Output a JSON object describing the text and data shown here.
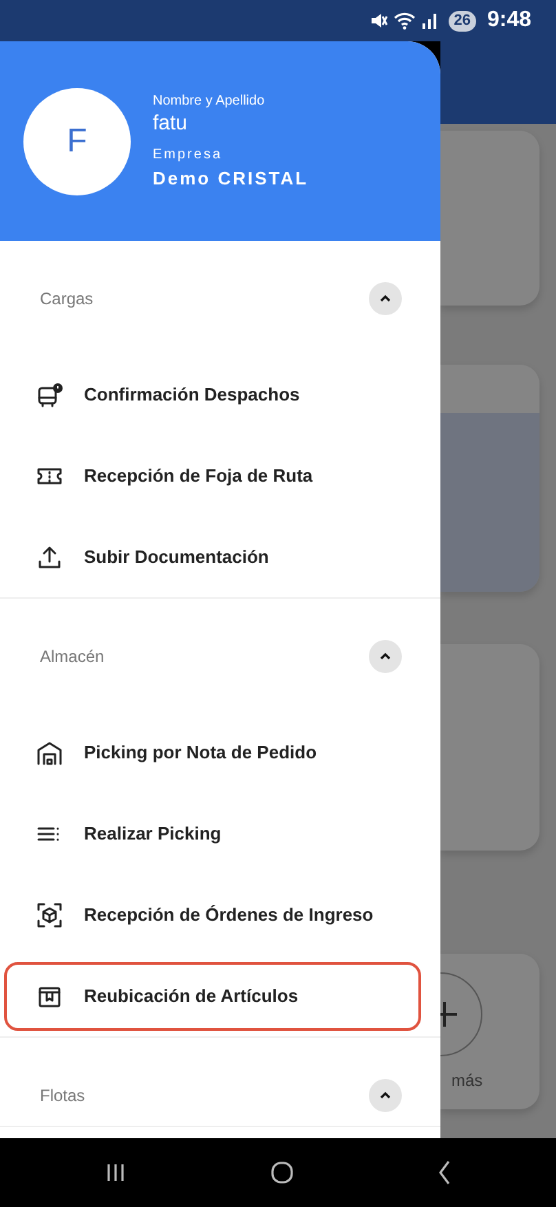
{
  "status_bar": {
    "battery": "26",
    "time": "9:48"
  },
  "drawer": {
    "avatar_letter": "F",
    "name_label": "Nombre y Apellido",
    "name": "fatu",
    "company_label": "Empresa",
    "company": "Demo CRISTAL",
    "sections": [
      {
        "title": "Cargas",
        "expanded": true,
        "items": [
          {
            "label": "Confirmación Despachos",
            "highlighted": false
          },
          {
            "label": "Recepción de Foja de Ruta",
            "highlighted": false
          },
          {
            "label": "Subir Documentación",
            "highlighted": false
          }
        ]
      },
      {
        "title": "Almacén",
        "expanded": true,
        "items": [
          {
            "label": "Picking por Nota de Pedido",
            "highlighted": false
          },
          {
            "label": "Realizar Picking",
            "highlighted": false
          },
          {
            "label": "Recepción de Órdenes de Ingreso",
            "highlighted": false
          },
          {
            "label": "Reubicación de Artículos",
            "highlighted": true
          }
        ]
      },
      {
        "title": "Flotas",
        "expanded": true
      }
    ]
  },
  "background": {
    "add_label": "más"
  }
}
